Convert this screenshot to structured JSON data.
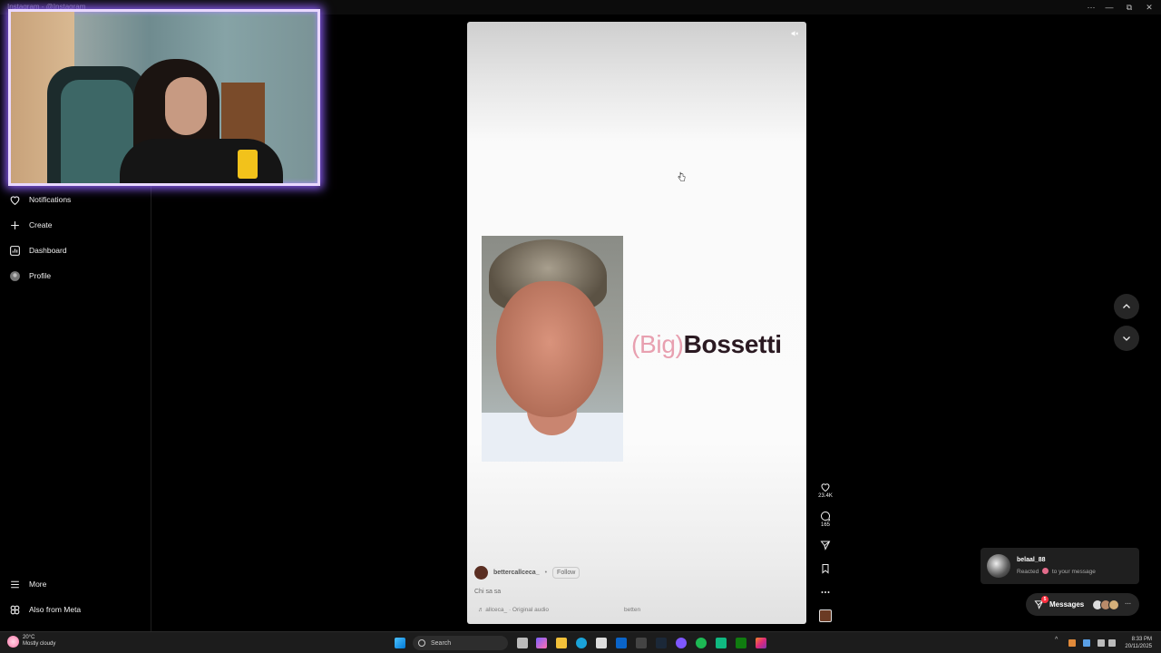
{
  "window": {
    "title": "Instagram - @Instagram",
    "controls": [
      "⋯",
      "—",
      "⧉",
      "✕"
    ]
  },
  "sidebar": {
    "items": [
      {
        "label": "Notifications",
        "icon": "heart-icon"
      },
      {
        "label": "Create",
        "icon": "plus-icon"
      },
      {
        "label": "Dashboard",
        "icon": "chart-icon"
      },
      {
        "label": "Profile",
        "icon": "avatar-icon"
      }
    ],
    "more": {
      "label": "More",
      "icon": "menu-icon"
    },
    "meta": {
      "label": "Also from Meta",
      "icon": "meta-icon"
    }
  },
  "reel": {
    "overlay_text_big": "(Big)",
    "overlay_text_name": "Bossetti",
    "author": "bettercallceca_",
    "separator": "•",
    "follow_label": "Follow",
    "caption": "Chi sa sa",
    "audio": "♬ allceca_ · Original audio",
    "audio_right": "betten",
    "likes": "23.4K",
    "comments": "165"
  },
  "toast": {
    "name": "belaal_88",
    "message_prefix": "Reacted",
    "message_suffix": "to your message"
  },
  "messages": {
    "label": "Messages",
    "badge": "5",
    "more": "···"
  },
  "taskbar": {
    "temperature": "20°C",
    "weather": "Mostly cloudy",
    "search_placeholder": "Search",
    "time": "8:33 PM",
    "date": "20/11/2025"
  },
  "colors": {
    "webcam_glow": "#8b5cf6",
    "badge": "#ff3040",
    "big_text": "#e8a0b0",
    "name_text": "#2b1a22"
  }
}
